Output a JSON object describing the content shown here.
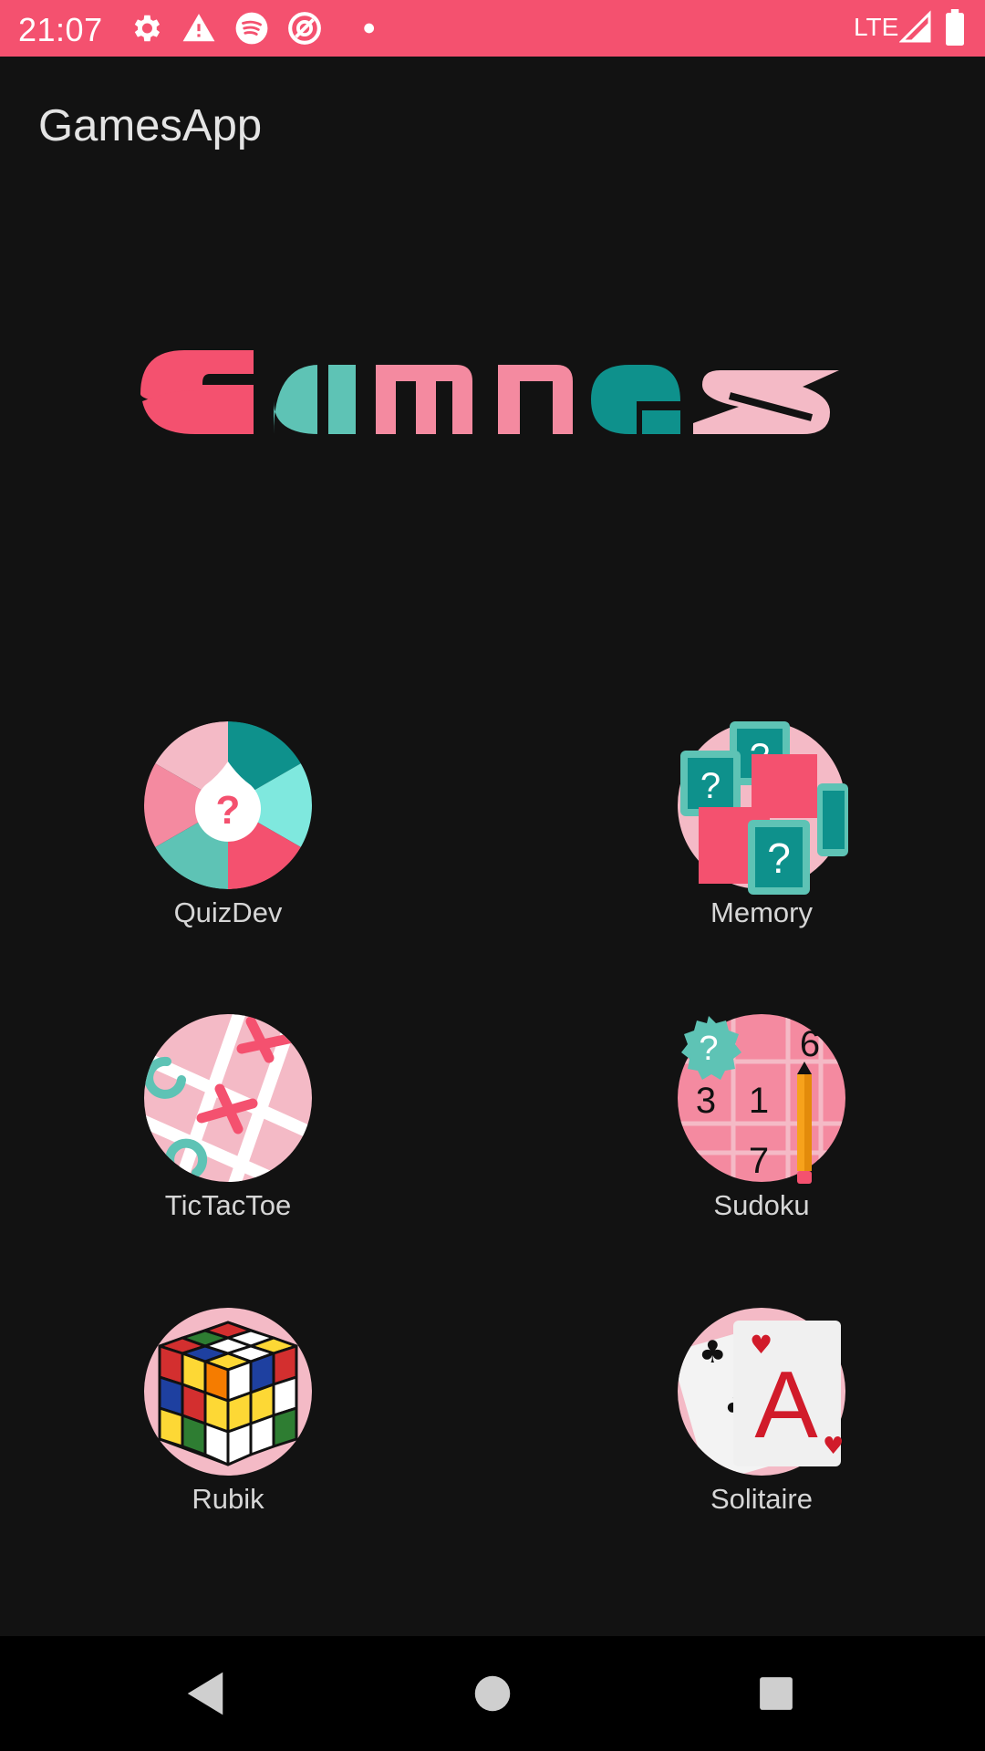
{
  "status_bar": {
    "time": "21:07",
    "network": "LTE",
    "left_icons": [
      "gear-icon",
      "warning-icon",
      "spotify-icon",
      "target-icon",
      "dot-icon"
    ],
    "right_icons": [
      "signal-icon",
      "battery-icon"
    ],
    "color": "#f4516f"
  },
  "app_bar": {
    "title": "GamesApp"
  },
  "logo": {
    "text": "Games",
    "colors": [
      "#f4516f",
      "#5ec3b5",
      "#f48aa0",
      "#f48aa0",
      "#0e918c",
      "#f4bac6"
    ]
  },
  "games": [
    {
      "label": "QuizDev",
      "icon": "quiz-wheel-icon"
    },
    {
      "label": "Memory",
      "icon": "memory-cards-icon"
    },
    {
      "label": "TicTacToe",
      "icon": "tictactoe-icon"
    },
    {
      "label": "Sudoku",
      "icon": "sudoku-icon"
    },
    {
      "label": "Rubik",
      "icon": "rubik-cube-icon"
    },
    {
      "label": "Solitaire",
      "icon": "playing-cards-icon"
    }
  ],
  "sudoku_digits": [
    "6",
    "3",
    "1",
    "7"
  ],
  "solitaire_card": "A",
  "nav_bar": {
    "buttons": [
      "back-icon",
      "home-icon",
      "recents-icon"
    ]
  }
}
